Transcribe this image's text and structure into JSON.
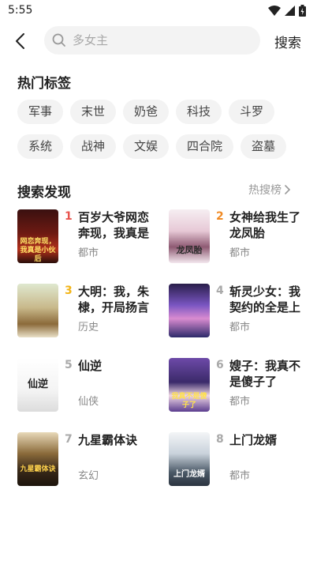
{
  "status_bar": {
    "time": "5:55"
  },
  "search": {
    "placeholder": "多女主",
    "button_label": "搜索"
  },
  "hot_tags": {
    "title": "热门标签",
    "tags": [
      "军事",
      "末世",
      "奶爸",
      "科技",
      "斗罗",
      "系统",
      "战神",
      "文娱",
      "四合院",
      "盗墓"
    ]
  },
  "discover": {
    "title": "搜索发现",
    "rank_link": "热搜榜",
    "rank_colors": {
      "1": "#e8544e",
      "2": "#f08a24",
      "3": "#f2b417",
      "other": "#a9a9a9"
    },
    "books": [
      {
        "rank": "1",
        "title": "百岁大爷网恋奔现，我真是",
        "genre": "都市",
        "cover_text": "网恋奔现，我真是小伙后"
      },
      {
        "rank": "2",
        "title": "女神给我生了龙凤胎",
        "genre": "都市",
        "cover_text": "龙凤胎"
      },
      {
        "rank": "3",
        "title": "大明：我，朱棣，开局扬言",
        "genre": "历史",
        "cover_text": ""
      },
      {
        "rank": "4",
        "title": "斩灵少女：我契约的全是上",
        "genre": "都市",
        "cover_text": ""
      },
      {
        "rank": "5",
        "title": "仙逆",
        "genre": "仙侠",
        "cover_text": "仙逆"
      },
      {
        "rank": "6",
        "title": "嫂子：我真不是傻子了",
        "genre": "都市",
        "cover_text": "我真不是傻子了"
      },
      {
        "rank": "7",
        "title": "九星霸体诀",
        "genre": "玄幻",
        "cover_text": "九星霸体诀"
      },
      {
        "rank": "8",
        "title": "上门龙婿",
        "genre": "都市",
        "cover_text": "上门龙婿"
      }
    ]
  }
}
